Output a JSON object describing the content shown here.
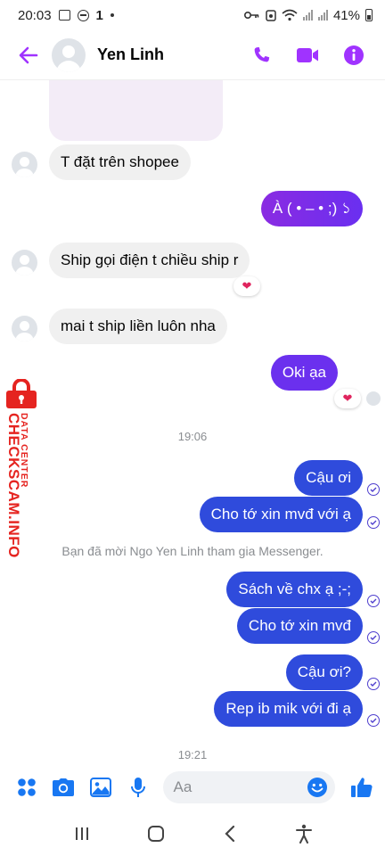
{
  "status_bar": {
    "time": "20:03",
    "extra": "1",
    "battery": "41%"
  },
  "header": {
    "contact_name": "Yen Linh"
  },
  "messages": {
    "m1": "T đặt trên shopee",
    "m2": "À ( • – • ;) ১",
    "m3": "Ship gọi điện t chiều ship r",
    "m3_reaction": "❤",
    "m4": "mai t ship liền luôn nha",
    "m5": "Oki ạa",
    "m5_reaction": "❤",
    "time_1": "19:06",
    "m6": "Cậu ơi",
    "m7": "Cho tớ xin mvđ với ạ",
    "system_note": "Bạn đã mời Ngo Yen Linh tham gia Messenger.",
    "m8": "Sách về chx ạ ;-;",
    "m9": "Cho tớ xin mvđ",
    "m10": "Cậu ơi?",
    "m11": "Rep ib mik với đi ạ",
    "time_2": "19:21"
  },
  "composer": {
    "placeholder": "Aa"
  },
  "watermark": {
    "line1": "DATA CENTER",
    "line2": "CHECKSCAM.INFO"
  },
  "colors": {
    "accent": "#a033ff",
    "outgoing": "#2f4bdc",
    "incoming": "#f0f0f0",
    "watermark": "#e52420"
  },
  "icons": [
    "back-arrow-icon",
    "phone-icon",
    "video-icon",
    "info-icon",
    "apps-icon",
    "camera-icon",
    "gallery-icon",
    "mic-icon",
    "emoji-icon",
    "like-icon",
    "recents-icon",
    "home-icon",
    "back-nav-icon",
    "accessibility-icon"
  ]
}
